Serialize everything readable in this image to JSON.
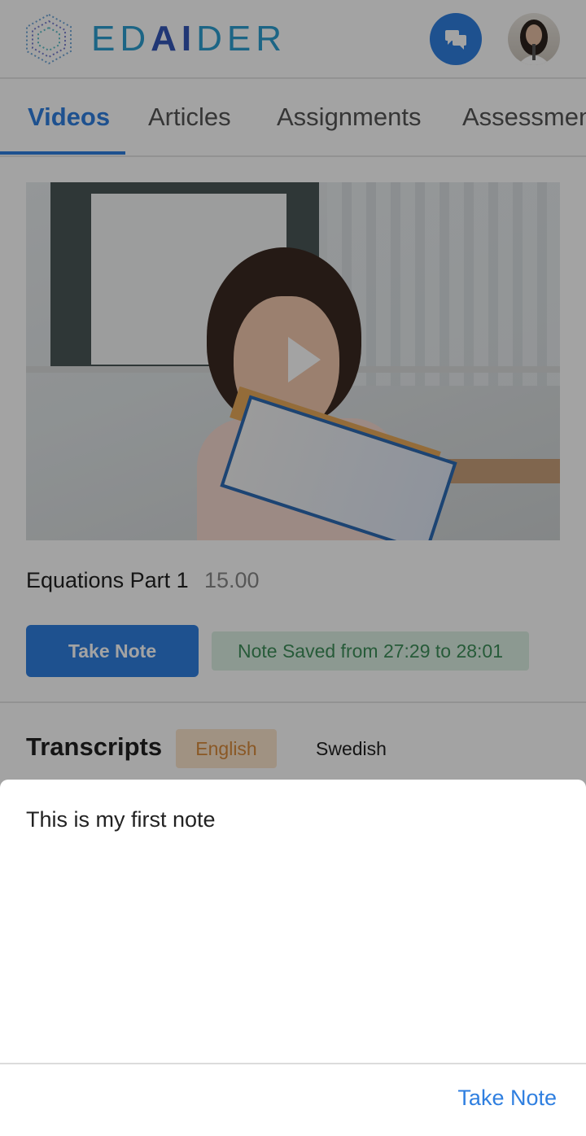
{
  "header": {
    "logo_text_left": "ED",
    "logo_text_ai": "AI",
    "logo_text_right": "DER",
    "chat_icon": "chat-bubbles-icon",
    "avatar_icon": "user-avatar"
  },
  "tabs": [
    {
      "label": "Videos",
      "active": true
    },
    {
      "label": "Articles",
      "active": false
    },
    {
      "label": "Assignments",
      "active": false
    },
    {
      "label": "Assessments",
      "active": false
    }
  ],
  "video": {
    "title": "Equations Part 1",
    "duration": "15.00",
    "play_icon": "play-icon"
  },
  "actions": {
    "take_note_label": "Take Note",
    "note_saved_text": "Note Saved from 27:29 to 28:01"
  },
  "transcripts": {
    "heading": "Transcripts",
    "languages": [
      {
        "label": "English",
        "active": true
      },
      {
        "label": "Swedish",
        "active": false
      }
    ]
  },
  "note_sheet": {
    "note_text": "This is my first note",
    "take_note_label": "Take Note"
  },
  "colors": {
    "accent": "#2f7fe0",
    "saved_bg": "#dcefe3",
    "saved_text": "#3d8f5a",
    "english_bg": "#fbe4cb",
    "english_text": "#d88a3a"
  }
}
